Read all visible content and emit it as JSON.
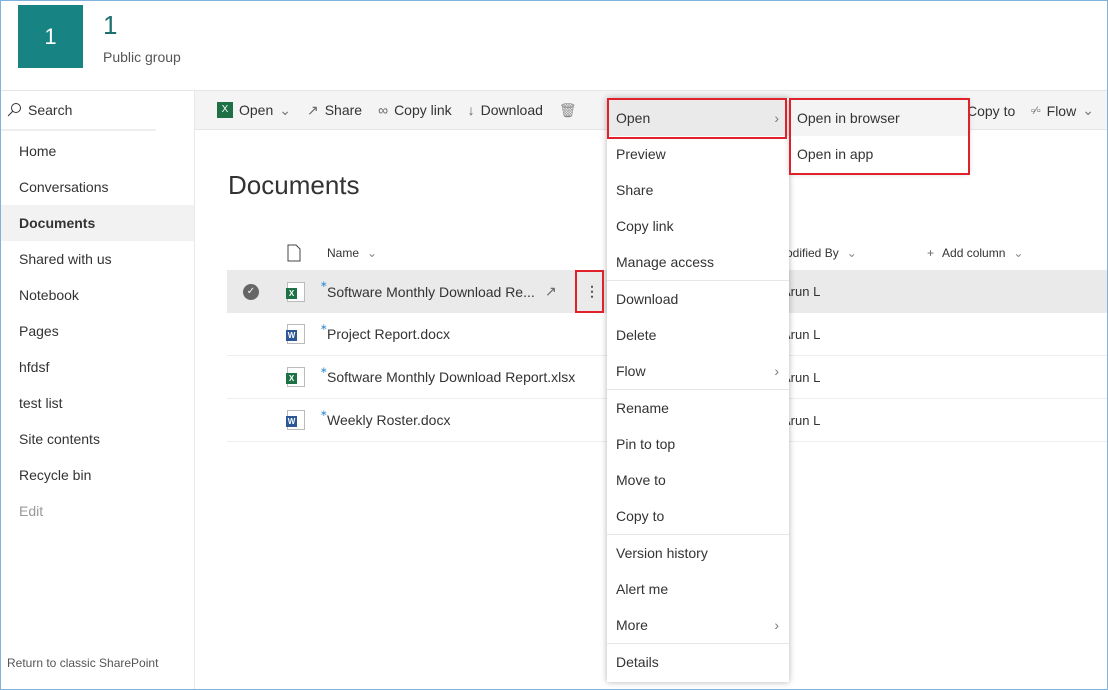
{
  "site": {
    "logo_text": "1",
    "title": "1",
    "subtitle": "Public group"
  },
  "nav": {
    "search": "Search",
    "items": [
      {
        "label": "Home"
      },
      {
        "label": "Conversations"
      },
      {
        "label": "Documents",
        "active": true
      },
      {
        "label": "Shared with us"
      },
      {
        "label": "Notebook"
      },
      {
        "label": "Pages"
      },
      {
        "label": "hfdsf"
      },
      {
        "label": "test list"
      },
      {
        "label": "Site contents"
      },
      {
        "label": "Recycle bin"
      },
      {
        "label": "Edit"
      }
    ],
    "classic": "Return to classic SharePoint"
  },
  "toolbar": {
    "open": "Open",
    "share": "Share",
    "copy_link": "Copy link",
    "download": "Download",
    "copy_to": "Copy to",
    "flow": "Flow"
  },
  "page_title": "Documents",
  "columns": {
    "name": "Name",
    "modified_by": "Modified By",
    "add_column": "Add column"
  },
  "files": [
    {
      "name": "Software Monthly Download Re...",
      "type": "xlsx",
      "modified_by": "Arun L",
      "selected": true
    },
    {
      "name": "Project Report.docx",
      "type": "docx",
      "modified_by": "Arun L"
    },
    {
      "name": "Software Monthly Download Report.xlsx",
      "type": "xlsx",
      "modified_by": "Arun L"
    },
    {
      "name": "Weekly Roster.docx",
      "type": "docx",
      "modified_by": "Arun L"
    }
  ],
  "context_menu": {
    "items": [
      "Open",
      "Preview",
      "Share",
      "Copy link",
      "Manage access",
      "Download",
      "Delete",
      "Flow",
      "Rename",
      "Pin to top",
      "Move to",
      "Copy to",
      "Version history",
      "Alert me",
      "More",
      "Details"
    ]
  },
  "submenu": {
    "items": [
      "Open in browser",
      "Open in app"
    ]
  },
  "colors": {
    "brand": "#178383",
    "highlight": "#e0202a",
    "excel": "#1e7145",
    "word": "#2b5797"
  }
}
